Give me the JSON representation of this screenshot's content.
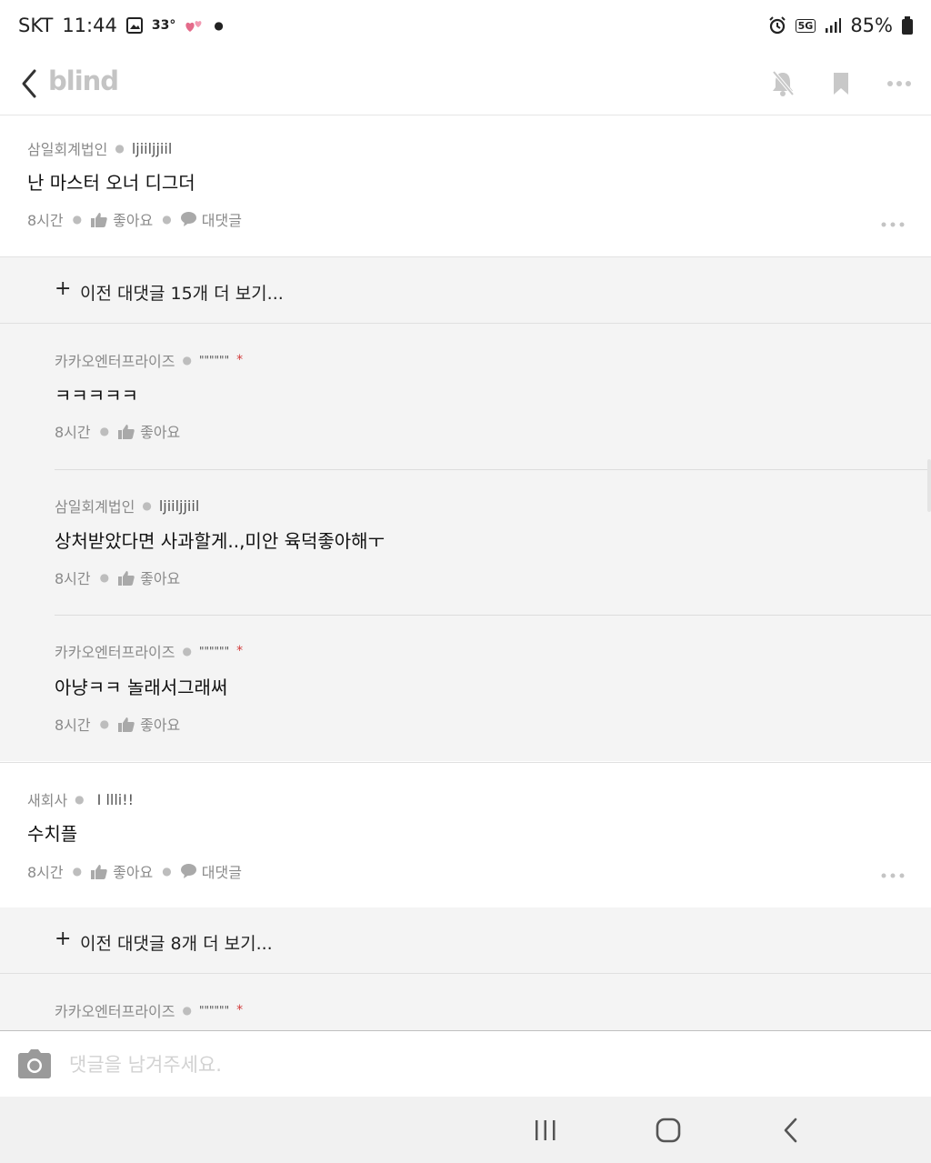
{
  "status": {
    "carrier": "SKT",
    "time": "11:44",
    "temperature": "33°",
    "network": "5G",
    "battery": "85%"
  },
  "app": {
    "logo": "blind",
    "icons": [
      "back-icon",
      "bell-off-icon",
      "bookmark-icon",
      "more-icon"
    ]
  },
  "thread": [
    {
      "company": "삼일회계법인",
      "nickname": "ljiiljjiil",
      "text": "난 마스터 오너 디그더",
      "time": "8시간",
      "like": "좋아요",
      "reply": "대댓글",
      "more_replies": "이전 대댓글 15개 더 보기...",
      "replies": [
        {
          "company": "카카오엔터프라이즈",
          "nickname": "\"\"\"\"\"\"",
          "text": "ㅋㅋㅋㅋㅋ",
          "time": "8시간",
          "like": "좋아요"
        },
        {
          "company": "삼일회계법인",
          "nickname": "ljiiljjiil",
          "text": "상처받았다면 사과할게..,미안  육덕좋아해ㅜ",
          "time": "8시간",
          "like": "좋아요"
        },
        {
          "company": "카카오엔터프라이즈",
          "nickname": "\"\"\"\"\"\"",
          "text": "아냥ㅋㅋ 놀래서그래써",
          "time": "8시간",
          "like": "좋아요"
        }
      ]
    },
    {
      "company": "새회사",
      "nickname": "I llli!!",
      "text": "수치플",
      "time": "8시간",
      "like": "좋아요",
      "reply": "대댓글",
      "more_replies": "이전 대댓글 8개 더 보기...",
      "replies": [
        {
          "company": "카카오엔터프라이즈",
          "nickname": "\"\"\"\"\"\""
        }
      ]
    }
  ],
  "input": {
    "placeholder": "댓글을 남겨주세요."
  },
  "colors": {
    "accent_star": "#d23b3b",
    "reply_bg": "#f4f4f4",
    "logo": "#c4c4c4"
  }
}
